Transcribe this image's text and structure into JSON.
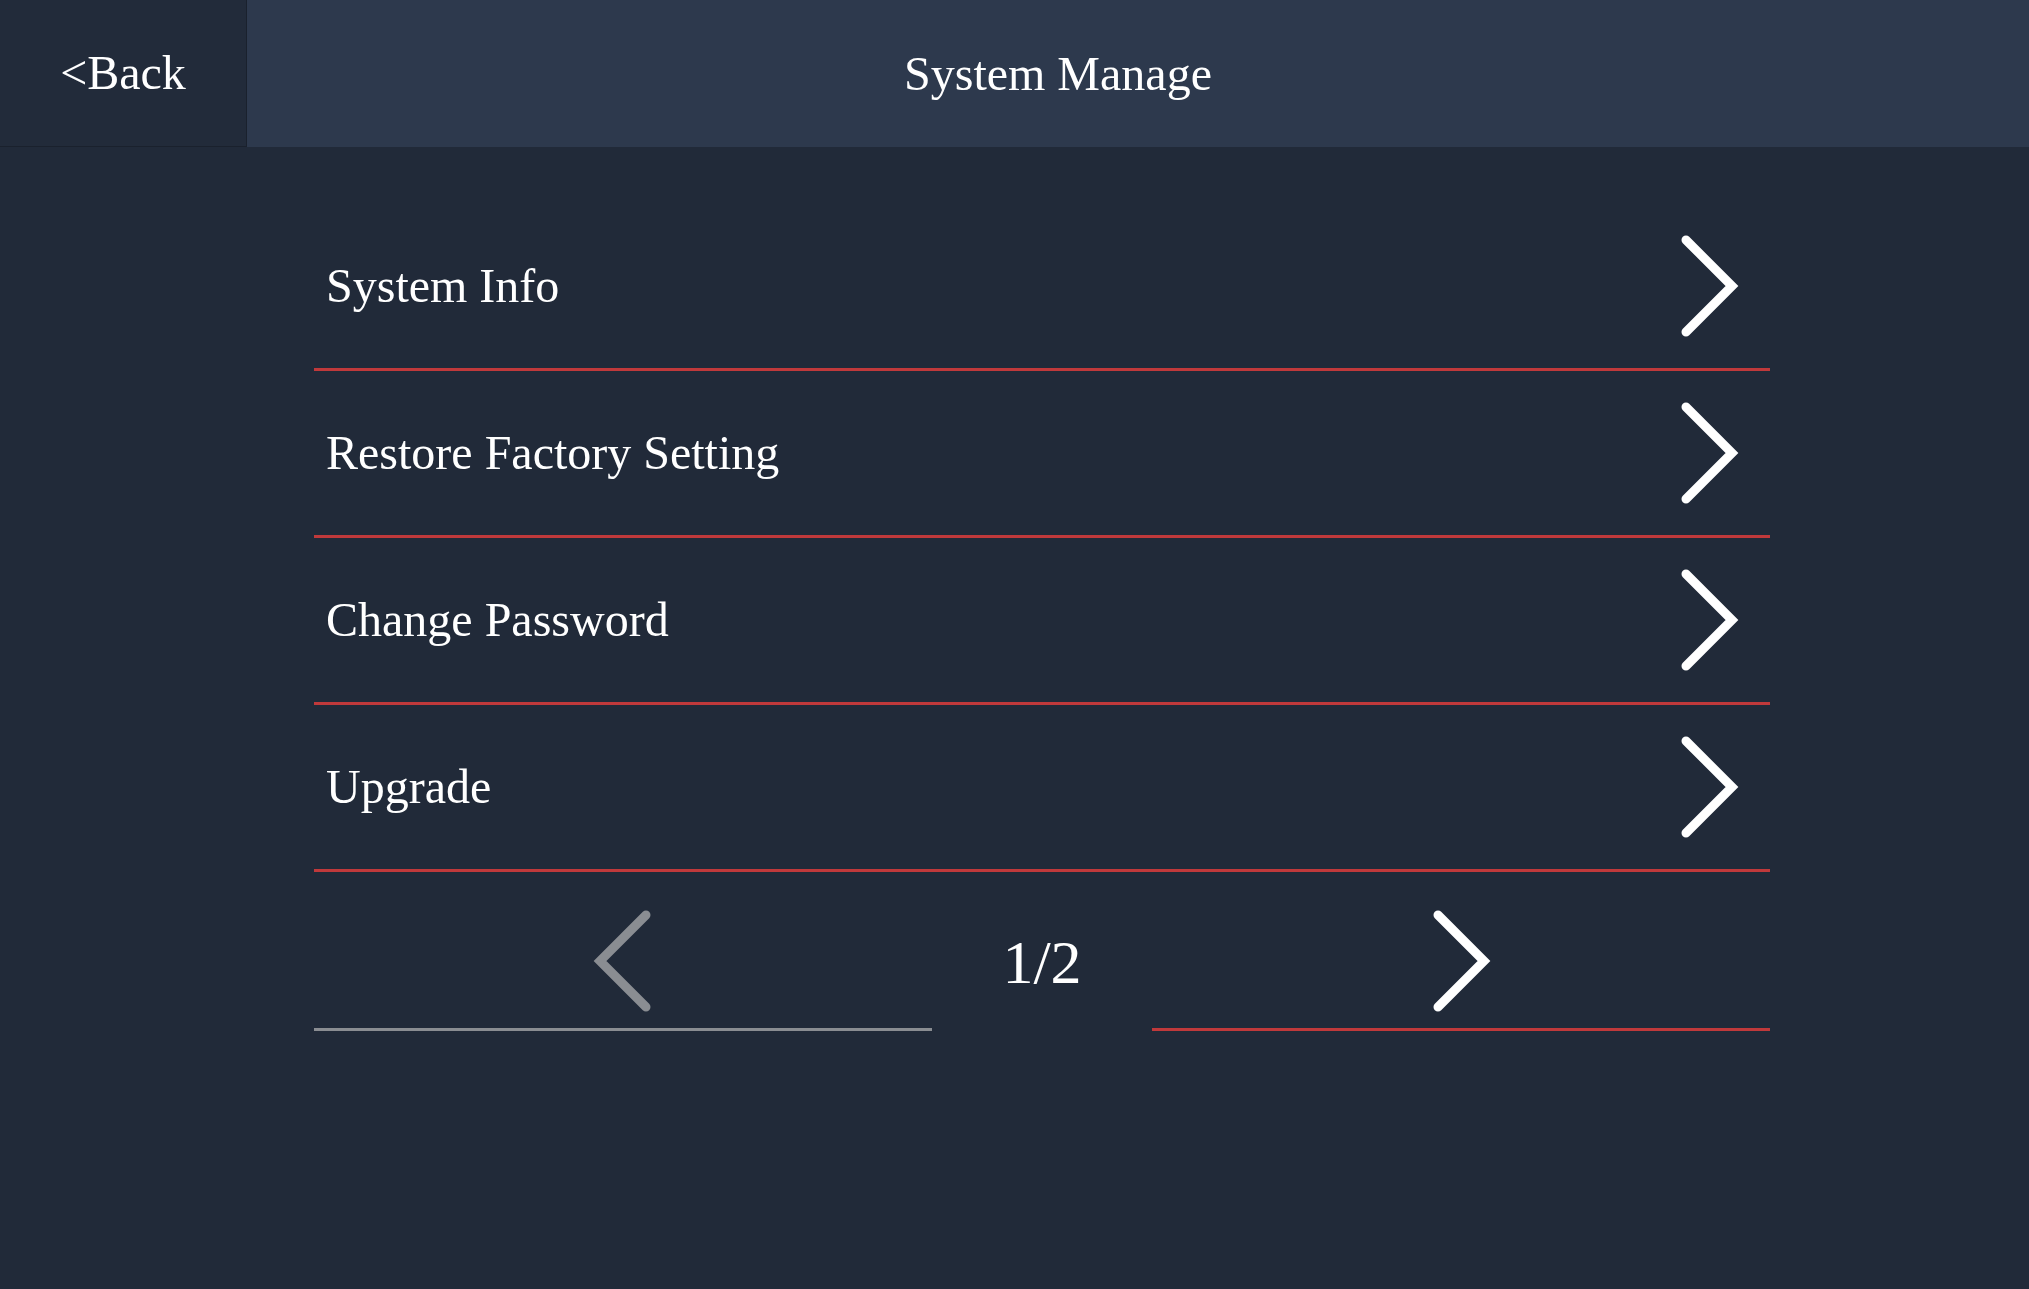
{
  "header": {
    "back": "<Back",
    "title": "System Manage"
  },
  "items": [
    {
      "label": "System Info"
    },
    {
      "label": "Restore Factory Setting"
    },
    {
      "label": "Change Password"
    },
    {
      "label": "Upgrade"
    }
  ],
  "pagination": {
    "page": "1/2",
    "prev_disabled": true,
    "next_disabled": false
  }
}
